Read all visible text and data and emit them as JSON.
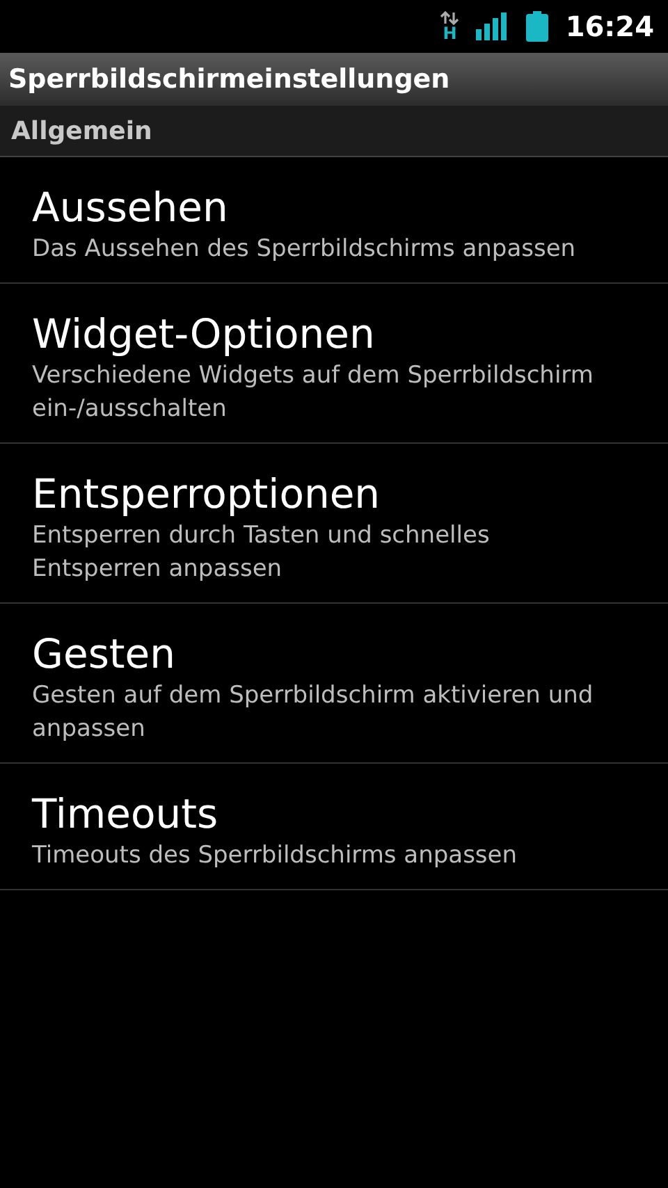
{
  "status_bar": {
    "network_type": "H",
    "time": "16:24"
  },
  "window": {
    "title": "Sperrbildschirmeinstellungen"
  },
  "section": {
    "label": "Allgemein"
  },
  "items": [
    {
      "title": "Aussehen",
      "summary": "Das Aussehen des Sperrbildschirms anpassen"
    },
    {
      "title": "Widget-Optionen",
      "summary": "Verschiedene Widgets auf dem Sperrbildschirm ein-/ausschalten"
    },
    {
      "title": "Entsperroptionen",
      "summary": "Entsperren durch Tasten und schnelles Entsperren anpassen"
    },
    {
      "title": "Gesten",
      "summary": "Gesten auf dem Sperrbildschirm aktivieren und anpassen"
    },
    {
      "title": "Timeouts",
      "summary": "Timeouts des Sperrbildschirms anpassen"
    }
  ]
}
